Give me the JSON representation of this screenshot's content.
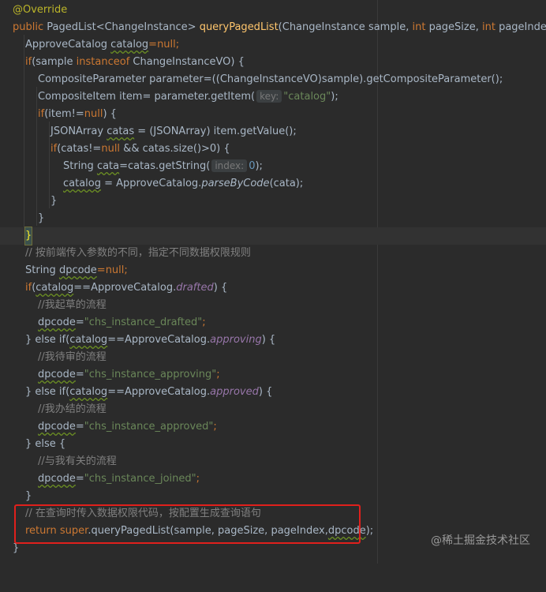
{
  "code": {
    "override": "@Override",
    "sig_public": "public ",
    "sig_type": "PagedList<ChangeInstance> ",
    "sig_name": "queryPagedList",
    "sig_params1": "(ChangeInstance sample, ",
    "sig_int1": "int",
    "sig_params2": " pageSize, ",
    "sig_int2": "int",
    "sig_params3": " pageIndex) {",
    "l3_type": "ApproveCatalog ",
    "l3_var": "catalog",
    "l3_rest": "=null;",
    "l4_if": "if",
    "l4_a": "(sample ",
    "l4_inst": "instanceof",
    "l4_b": " ChangeInstanceVO) {",
    "l5": "CompositeParameter parameter=((ChangeInstanceVO)sample).getCompositeParameter();",
    "l6_a": "CompositeItem item= parameter.getItem(",
    "l6_hint": "key:",
    "l6_str": "\"catalog\"",
    "l6_b": ");",
    "l7_if": "if",
    "l7_a": "(item!=",
    "l7_null": "null",
    "l7_b": ") {",
    "l8_a": "JSONArray ",
    "l8_var": "catas",
    "l8_b": " = (JSONArray) item.getValue();",
    "l9_if": "if",
    "l9_a": "(catas!=",
    "l9_null": "null",
    "l9_b": " && catas.size()>0) {",
    "l10_a": "String ",
    "l10_var": "cata",
    "l10_b": "=catas.getString(",
    "l10_hint": "index:",
    "l10_num": "0",
    "l10_c": ");",
    "l11_var": "catalog",
    "l11_a": " = ApproveCatalog.",
    "l11_fn": "parseByCode",
    "l11_b": "(cata);",
    "close": "}",
    "c1": "// 按前端传入参数的不同，指定不同数据权限规则",
    "l16_a": "String ",
    "l16_var": "dpcode",
    "l16_b": "=null;",
    "l17_if": "if",
    "l17_var": "catalog",
    "l17_a": "==ApproveCatalog.",
    "l17_const": "drafted",
    "l17_b": ") {",
    "c2": "//我起草的流程",
    "dp": "dpcode",
    "eq": "=",
    "s1": "\"chs_instance_drafted\"",
    "semi": ";",
    "elseif": "} else if(",
    "l20_const": "approving",
    "c3": "//我待审的流程",
    "s2": "\"chs_instance_approving\"",
    "l23_const": "approved",
    "c4": "//我办结的流程",
    "s3": "\"chs_instance_approved\"",
    "else": "} else {",
    "c5": "//与我有关的流程",
    "s4": "\"chs_instance_joined\"",
    "c6": "// 在查询时传入数据权限代码，按配置生成查询语句",
    "ret": "return ",
    "sup": "super",
    "ret_a": ".queryPagedList(sample, pageSize, pageIndex,",
    "ret_var": "dpcode",
    "ret_b": ");"
  },
  "watermark": "@稀土掘金技术社区"
}
